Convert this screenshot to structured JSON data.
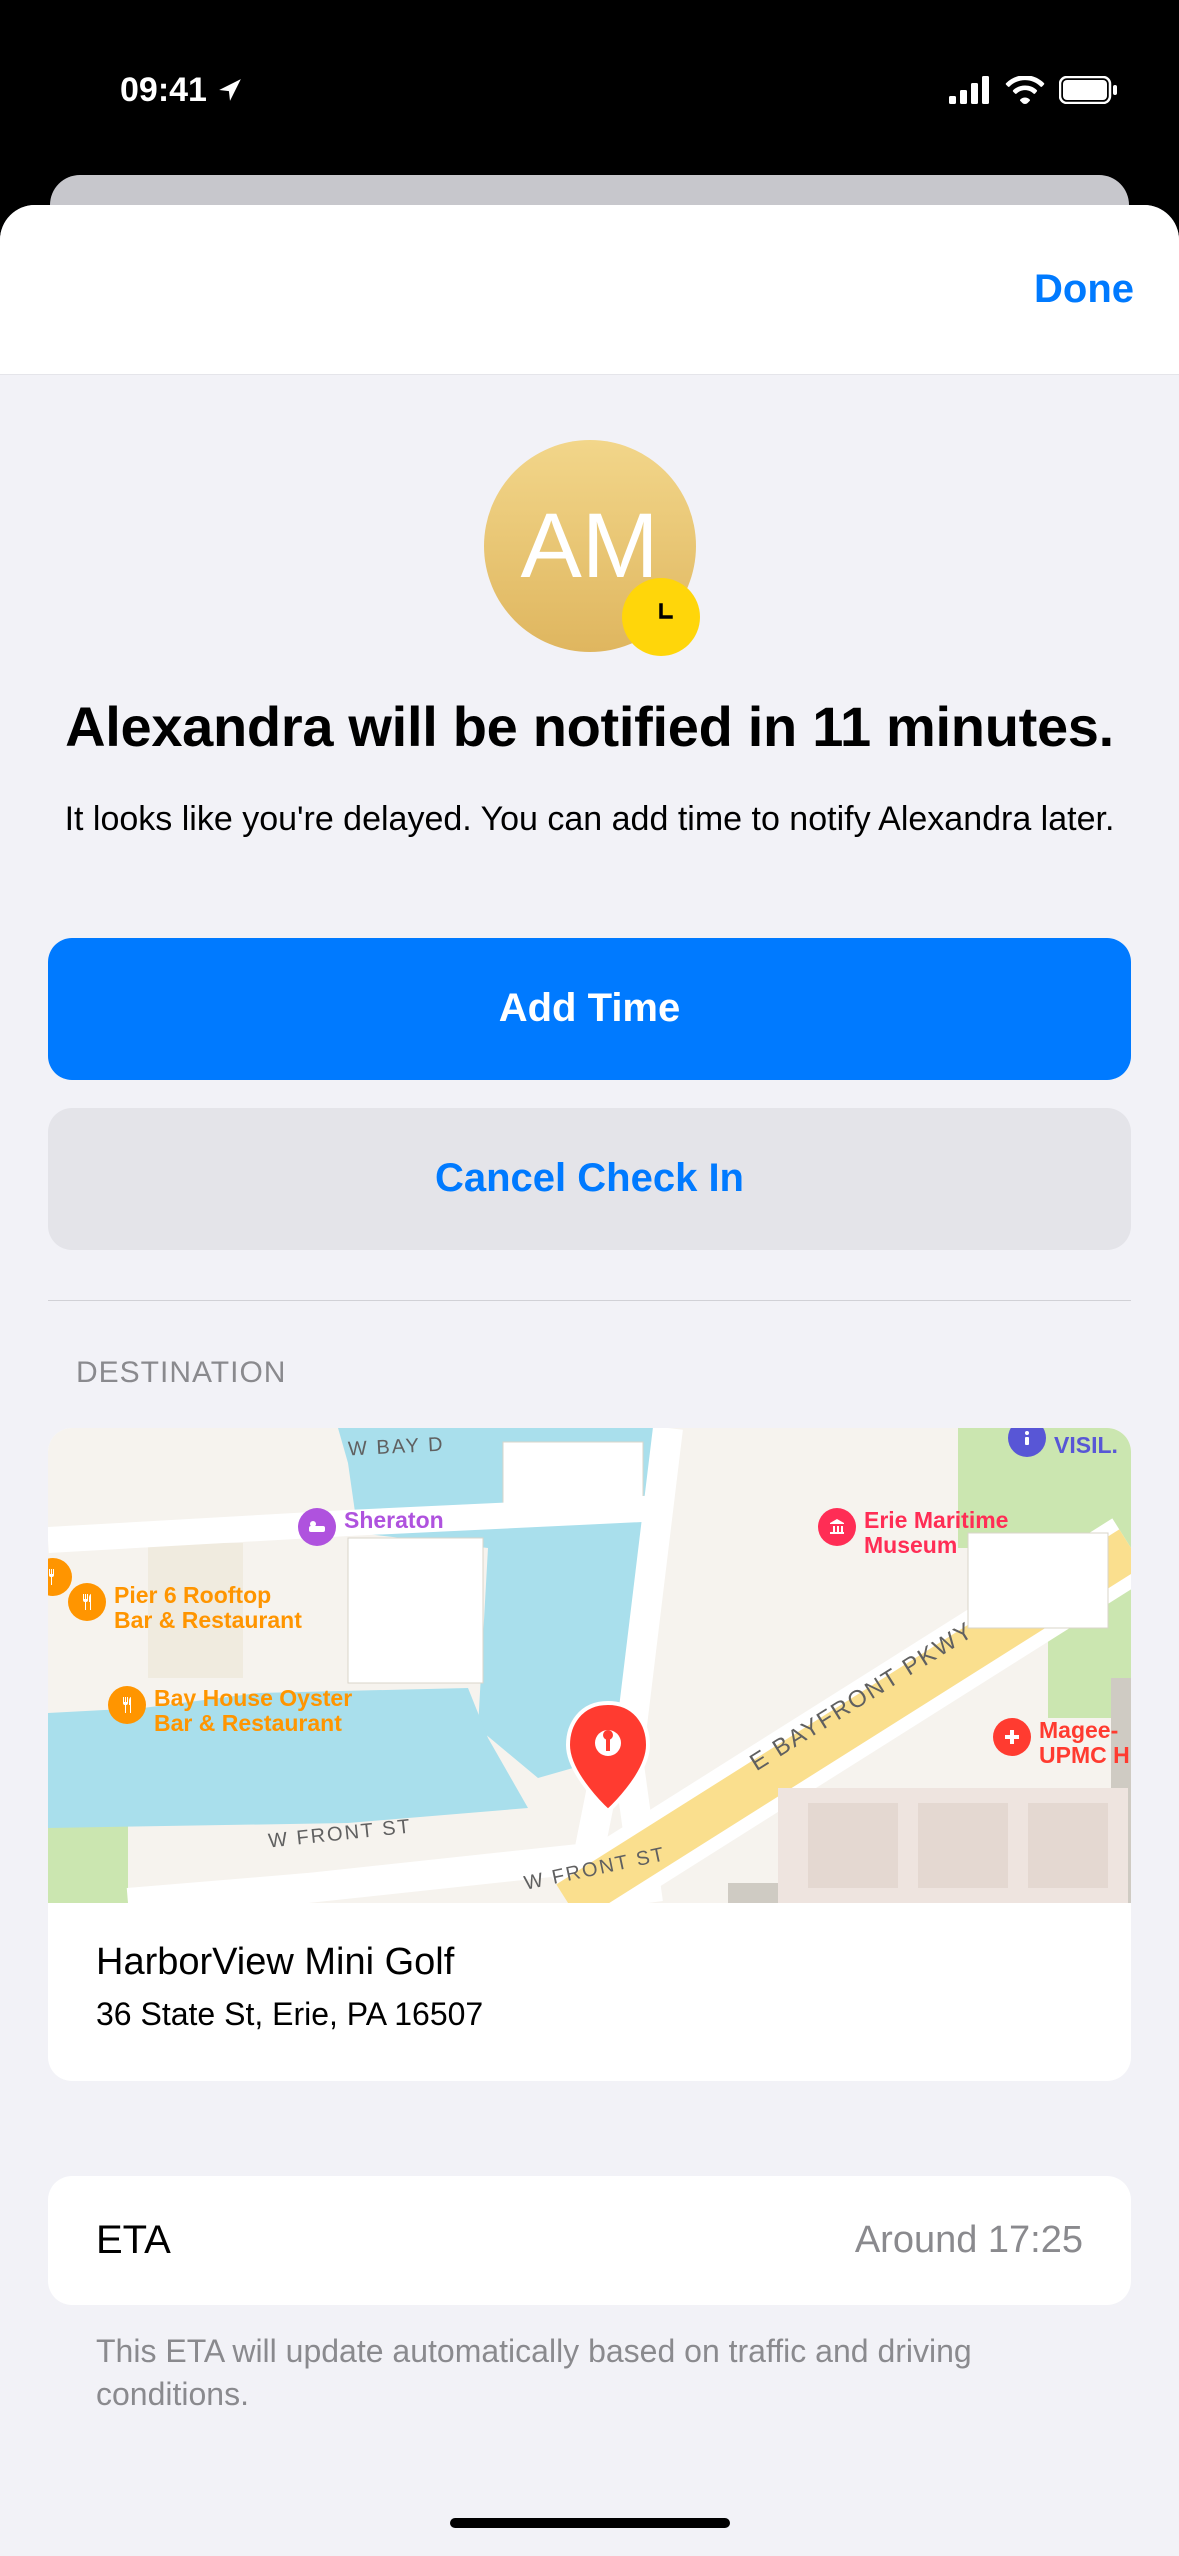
{
  "status": {
    "time": "09:41"
  },
  "header": {
    "done": "Done"
  },
  "avatar": {
    "initials": "AM"
  },
  "title": "Alexandra will be notified in 11 minutes.",
  "subtitle": "It looks like you're delayed. You can add time to notify Alexandra later.",
  "buttons": {
    "primary": "Add Time",
    "secondary": "Cancel Check In"
  },
  "destination": {
    "label": "DESTINATION",
    "name": "HarborView Mini Golf",
    "address": "36 State St, Erie, PA  16507",
    "map": {
      "pois": {
        "sheraton": "Sheraton",
        "pier6": "Pier 6 Rooftop\nBar & Restaurant",
        "bayhouse": "Bay House Oyster\nBar & Restaurant",
        "erie_maritime": "Erie Maritime\nMuseum",
        "magee": "Magee-\nUPMC H",
        "visit": "VISIL."
      },
      "roads": {
        "wbay": "W BAY D",
        "wfront": "W FRONT ST",
        "wfront2": "W FRONT ST",
        "bayfront": "E BAYFRONT PKWY"
      }
    }
  },
  "eta": {
    "label": "ETA",
    "value": "Around 17:25",
    "note": "This ETA will update automatically based on traffic and driving conditions."
  }
}
